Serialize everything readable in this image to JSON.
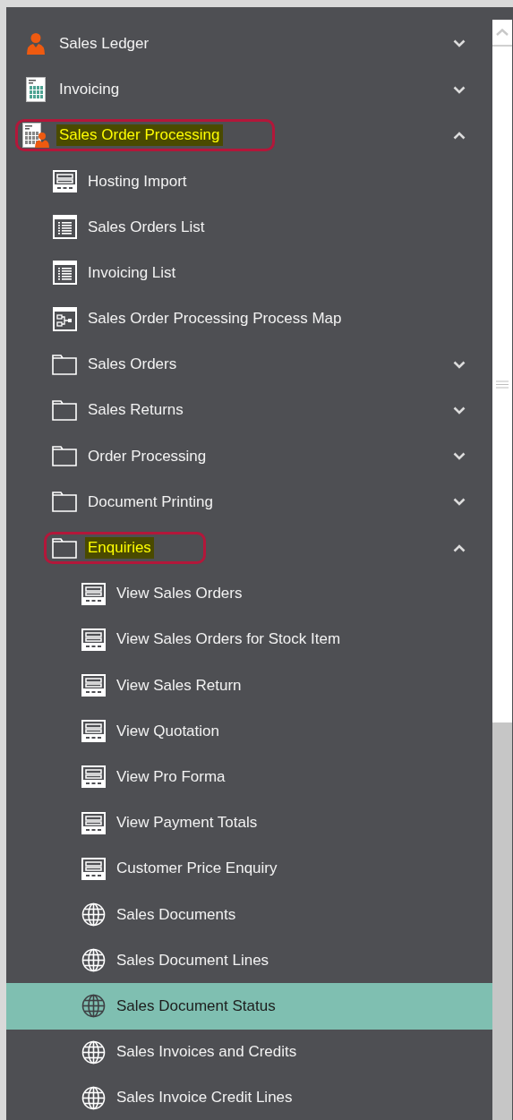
{
  "navigation": [
    {
      "label": "Sales Ledger",
      "kind": "person",
      "expanded": false,
      "selected": false,
      "highlighted": false
    },
    {
      "label": "Invoicing",
      "kind": "calculator",
      "expanded": false,
      "selected": false,
      "highlighted": false
    },
    {
      "label": "Sales Order Processing",
      "kind": "calculator-person",
      "expanded": true,
      "selected": false,
      "highlighted": true,
      "children": [
        {
          "label": "Hosting Import",
          "kind": "form",
          "selected": false,
          "highlighted": false
        },
        {
          "label": "Sales Orders List",
          "kind": "list",
          "selected": false,
          "highlighted": false
        },
        {
          "label": "Invoicing List",
          "kind": "list",
          "selected": false,
          "highlighted": false
        },
        {
          "label": "Sales Order Processing Process Map",
          "kind": "map",
          "selected": false,
          "highlighted": false
        },
        {
          "label": "Sales Orders",
          "kind": "folder",
          "expanded": false,
          "selected": false,
          "highlighted": false
        },
        {
          "label": "Sales Returns",
          "kind": "folder",
          "expanded": false,
          "selected": false,
          "highlighted": false
        },
        {
          "label": "Order Processing",
          "kind": "folder",
          "expanded": false,
          "selected": false,
          "highlighted": false
        },
        {
          "label": "Document Printing",
          "kind": "folder",
          "expanded": false,
          "selected": false,
          "highlighted": false
        },
        {
          "label": "Enquiries",
          "kind": "folder",
          "expanded": true,
          "selected": false,
          "highlighted": true,
          "children": [
            {
              "label": "View Sales Orders",
              "kind": "form",
              "selected": false,
              "highlighted": false
            },
            {
              "label": "View Sales Orders for Stock Item",
              "kind": "form",
              "selected": false,
              "highlighted": false
            },
            {
              "label": "View Sales Return",
              "kind": "form",
              "selected": false,
              "highlighted": false
            },
            {
              "label": "View Quotation",
              "kind": "form",
              "selected": false,
              "highlighted": false
            },
            {
              "label": "View Pro Forma",
              "kind": "form",
              "selected": false,
              "highlighted": false
            },
            {
              "label": "View Payment Totals",
              "kind": "form",
              "selected": false,
              "highlighted": false
            },
            {
              "label": "Customer Price Enquiry",
              "kind": "form",
              "selected": false,
              "highlighted": false
            },
            {
              "label": "Sales Documents",
              "kind": "globe",
              "selected": false,
              "highlighted": false
            },
            {
              "label": "Sales Document Lines",
              "kind": "globe",
              "selected": false,
              "highlighted": false
            },
            {
              "label": "Sales Document Status",
              "kind": "globe",
              "selected": true,
              "highlighted": false
            },
            {
              "label": "Sales Invoices and Credits",
              "kind": "globe",
              "selected": false,
              "highlighted": false
            },
            {
              "label": "Sales Invoice Credit Lines",
              "kind": "globe",
              "selected": false,
              "highlighted": false
            }
          ]
        }
      ]
    }
  ]
}
